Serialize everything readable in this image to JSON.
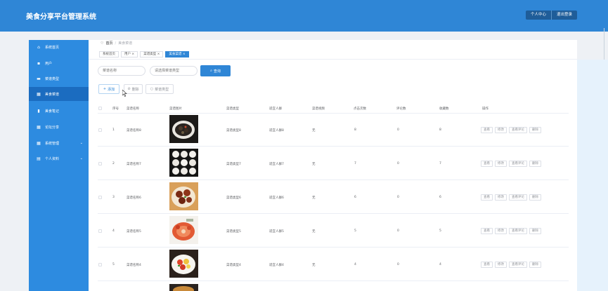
{
  "app": {
    "title": "美食分享平台管理系统"
  },
  "header": {
    "profile_label": "个人中心",
    "logout_label": "退出登录"
  },
  "sidebar": {
    "items": [
      {
        "label": "系统首页",
        "icon": "home-icon",
        "glyph": "⌂"
      },
      {
        "label": "用户",
        "icon": "user-icon",
        "glyph": "▪"
      },
      {
        "label": "菜谱类型",
        "icon": "bowl-icon",
        "glyph": "▬"
      },
      {
        "label": "美食菜谱",
        "icon": "grid-icon",
        "glyph": "▦",
        "active": true
      },
      {
        "label": "美食笔记",
        "icon": "chart-icon",
        "glyph": "▮"
      },
      {
        "label": "论坛分享",
        "icon": "grid-icon",
        "glyph": "▦"
      },
      {
        "label": "系统管理",
        "icon": "grid-icon",
        "glyph": "▦",
        "arrow": "⌄"
      },
      {
        "label": "个人资料",
        "icon": "calendar-icon",
        "glyph": "▤",
        "arrow": "⌄"
      }
    ]
  },
  "breadcrumb": {
    "home": "首页",
    "separator": "/",
    "current": "美食菜谱",
    "heart_glyph": "♡"
  },
  "tabs": [
    {
      "label": "系统首页"
    },
    {
      "label": "用户 ×"
    },
    {
      "label": "菜谱类型 ×"
    },
    {
      "label": "美食菜谱 ×",
      "active": true
    }
  ],
  "search": {
    "name_placeholder": "菜谱名称",
    "type_placeholder": "请选择菜谱类型",
    "query_label": "查询",
    "query_icon_glyph": "⌕"
  },
  "toolbar": {
    "add_label": "添加",
    "add_glyph": "+",
    "delete_label": "删除",
    "delete_glyph": "⊘",
    "type_label": "菜谱类型",
    "type_glyph": "○"
  },
  "table": {
    "columns": [
      "序号",
      "菜谱名称",
      "菜谱图片",
      "菜谱类型",
      "适宜人群",
      "菜谱视频",
      "点击次数",
      "评论数",
      "收藏数",
      "操作"
    ],
    "actions": [
      "查看",
      "修改",
      "查看评论",
      "删除"
    ],
    "rows": [
      {
        "index": "1",
        "name": "菜谱名称8",
        "image": "dish-1",
        "type": "菜谱类型8",
        "crowd": "适宜人群8",
        "video": "无",
        "clicks": "8",
        "comments": "0",
        "favorites": "8"
      },
      {
        "index": "2",
        "name": "菜谱名称7",
        "image": "dish-2",
        "type": "菜谱类型7",
        "crowd": "适宜人群7",
        "video": "无",
        "clicks": "7",
        "comments": "0",
        "favorites": "7"
      },
      {
        "index": "3",
        "name": "菜谱名称6",
        "image": "dish-3",
        "type": "菜谱类型6",
        "crowd": "适宜人群6",
        "video": "无",
        "clicks": "6",
        "comments": "0",
        "favorites": "6"
      },
      {
        "index": "4",
        "name": "菜谱名称5",
        "image": "dish-4",
        "type": "菜谱类型5",
        "crowd": "适宜人群5",
        "video": "无",
        "clicks": "5",
        "comments": "0",
        "favorites": "5"
      },
      {
        "index": "5",
        "name": "菜谱名称4",
        "image": "dish-5",
        "type": "菜谱类型4",
        "crowd": "适宜人群4",
        "video": "无",
        "clicks": "4",
        "comments": "0",
        "favorites": "4"
      }
    ]
  },
  "colors": {
    "primary": "#2f86d6",
    "sidebar": "#2d8be0",
    "sidebar_active": "#1b6cc0",
    "header_button": "#1f5d99"
  }
}
